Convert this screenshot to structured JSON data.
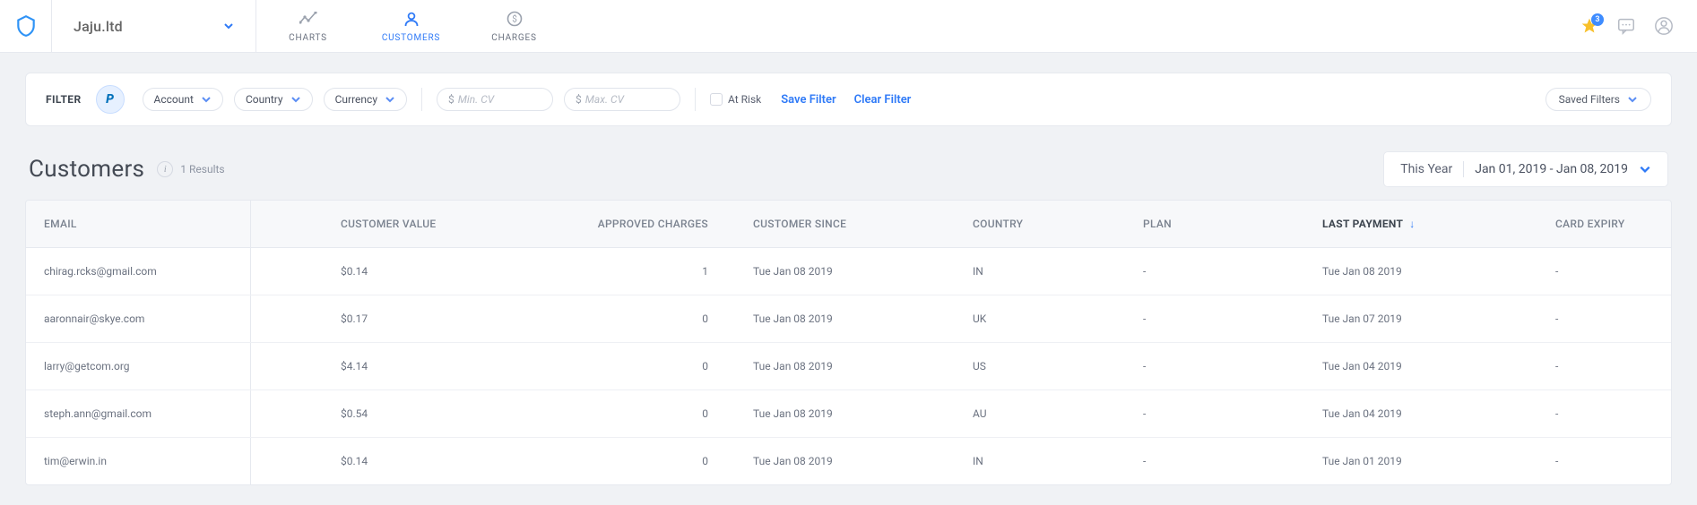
{
  "org": {
    "name": "Jaju.ltd"
  },
  "nav": {
    "charts": "CHARTS",
    "customers": "CUSTOMERS",
    "charges": "CHARGES"
  },
  "topbar": {
    "star_count": "3"
  },
  "filter": {
    "label": "FILTER",
    "account": "Account",
    "country": "Country",
    "currency": "Currency",
    "min_cv_placeholder": "Min. CV",
    "max_cv_placeholder": "Max. CV",
    "at_risk": "At Risk",
    "save": "Save Filter",
    "clear": "Clear Filter",
    "saved": "Saved Filters"
  },
  "section": {
    "title": "Customers",
    "results": "1 Results",
    "date_preset": "This Year",
    "date_range": "Jan 01, 2019 - Jan 08, 2019"
  },
  "columns": {
    "email": "EMAIL",
    "value": "CUSTOMER VALUE",
    "charges": "APPROVED CHARGES",
    "since": "CUSTOMER SINCE",
    "country": "COUNTRY",
    "plan": "PLAN",
    "payment": "LAST PAYMENT",
    "expiry": "CARD EXPIRY"
  },
  "rows": [
    {
      "email": "chirag.rcks@gmail.com",
      "value": "$0.14",
      "charges": "1",
      "since": "Tue Jan 08 2019",
      "country": "IN",
      "plan": "-",
      "payment": "Tue Jan 08 2019",
      "expiry": "-"
    },
    {
      "email": "aaronnair@skye.com",
      "value": "$0.17",
      "charges": "0",
      "since": "Tue Jan 08 2019",
      "country": "UK",
      "plan": "-",
      "payment": "Tue Jan 07 2019",
      "expiry": "-"
    },
    {
      "email": "larry@getcom.org",
      "value": "$4.14",
      "charges": "0",
      "since": "Tue Jan 08 2019",
      "country": "US",
      "plan": "-",
      "payment": "Tue Jan 04 2019",
      "expiry": "-"
    },
    {
      "email": "steph.ann@gmail.com",
      "value": "$0.54",
      "charges": "0",
      "since": "Tue Jan 08 2019",
      "country": "AU",
      "plan": "-",
      "payment": "Tue Jan 04 2019",
      "expiry": "-"
    },
    {
      "email": "tim@erwin.in",
      "value": "$0.14",
      "charges": "0",
      "since": "Tue Jan 08 2019",
      "country": "IN",
      "plan": "-",
      "payment": "Tue Jan 01 2019",
      "expiry": "-"
    }
  ]
}
